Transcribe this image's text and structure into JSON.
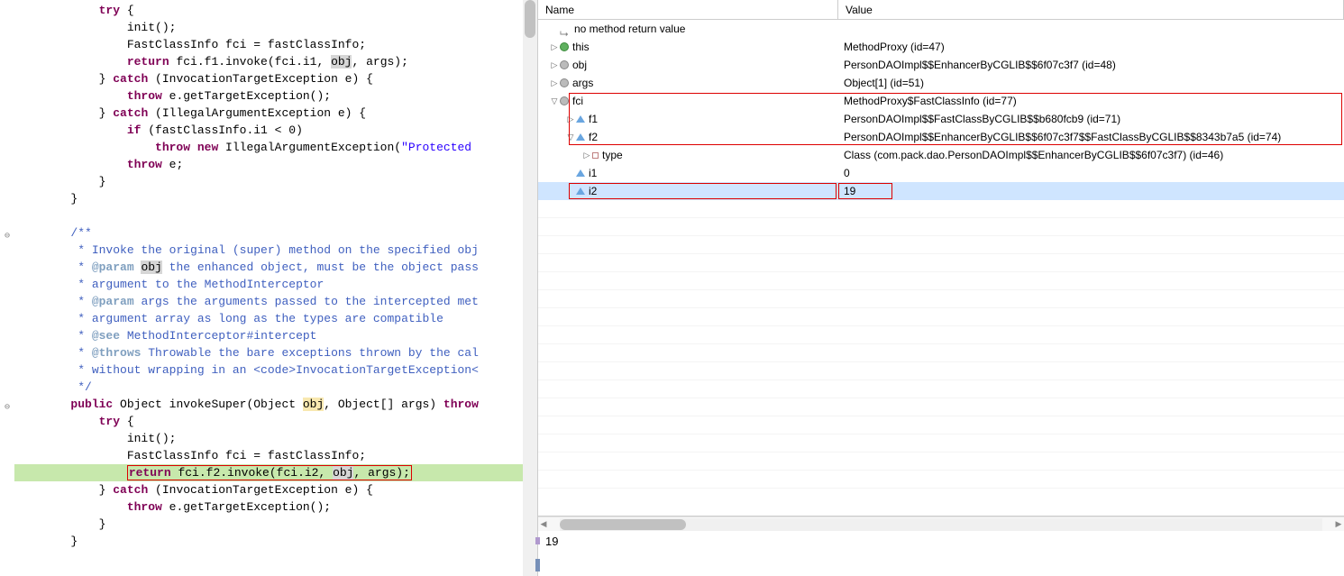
{
  "code_lines": [
    {
      "indent": 2,
      "segments": [
        {
          "t": "try",
          "c": "kw"
        },
        {
          "t": " {"
        }
      ]
    },
    {
      "indent": 3,
      "segments": [
        {
          "t": "init();"
        }
      ]
    },
    {
      "indent": 3,
      "segments": [
        {
          "t": "FastClassInfo fci = fastClassInfo;"
        }
      ]
    },
    {
      "indent": 3,
      "segments": [
        {
          "t": "return",
          "c": "kw"
        },
        {
          "t": " fci.f1.invoke(fci.i1, "
        },
        {
          "t": "obj",
          "c": "hl-var"
        },
        {
          "t": ", args);"
        }
      ]
    },
    {
      "indent": 2,
      "segments": [
        {
          "t": "} "
        },
        {
          "t": "catch",
          "c": "kw"
        },
        {
          "t": " (InvocationTargetException e) {"
        }
      ]
    },
    {
      "indent": 3,
      "segments": [
        {
          "t": "throw",
          "c": "kw"
        },
        {
          "t": " e.getTargetException();"
        }
      ]
    },
    {
      "indent": 2,
      "segments": [
        {
          "t": "} "
        },
        {
          "t": "catch",
          "c": "kw"
        },
        {
          "t": " (IllegalArgumentException e) {"
        }
      ]
    },
    {
      "indent": 3,
      "segments": [
        {
          "t": "if",
          "c": "kw"
        },
        {
          "t": " (fastClassInfo.i1 < 0)"
        }
      ]
    },
    {
      "indent": 4,
      "segments": [
        {
          "t": "throw new",
          "c": "kw"
        },
        {
          "t": " IllegalArgumentException("
        },
        {
          "t": "\"Protected",
          "c": "str"
        }
      ]
    },
    {
      "indent": 3,
      "segments": [
        {
          "t": "throw",
          "c": "kw"
        },
        {
          "t": " e;"
        }
      ]
    },
    {
      "indent": 2,
      "segments": [
        {
          "t": "}"
        }
      ]
    },
    {
      "indent": 1,
      "segments": [
        {
          "t": "}"
        }
      ]
    },
    {
      "indent": 0,
      "segments": [
        {
          "t": ""
        }
      ]
    },
    {
      "indent": 1,
      "segments": [
        {
          "t": "/**",
          "c": "cmt"
        }
      ],
      "fold": true
    },
    {
      "indent": 1,
      "segments": [
        {
          "t": " * Invoke the original (super) method on the specified obj",
          "c": "cmt"
        }
      ]
    },
    {
      "indent": 1,
      "segments": [
        {
          "t": " * ",
          "c": "cmt"
        },
        {
          "t": "@param",
          "c": "ann"
        },
        {
          "t": " ",
          "c": "cmt"
        },
        {
          "t": "obj",
          "c": "hl-var"
        },
        {
          "t": " the enhanced object, must be the object pass",
          "c": "cmt"
        }
      ]
    },
    {
      "indent": 1,
      "segments": [
        {
          "t": " * argument to the MethodInterceptor",
          "c": "cmt"
        }
      ]
    },
    {
      "indent": 1,
      "segments": [
        {
          "t": " * ",
          "c": "cmt"
        },
        {
          "t": "@param",
          "c": "ann"
        },
        {
          "t": " args the arguments passed to the intercepted met",
          "c": "cmt"
        }
      ]
    },
    {
      "indent": 1,
      "segments": [
        {
          "t": " * argument array as long as the types are compatible",
          "c": "cmt"
        }
      ]
    },
    {
      "indent": 1,
      "segments": [
        {
          "t": " * ",
          "c": "cmt"
        },
        {
          "t": "@see",
          "c": "ann"
        },
        {
          "t": " MethodInterceptor#intercept",
          "c": "cmt"
        }
      ]
    },
    {
      "indent": 1,
      "segments": [
        {
          "t": " * ",
          "c": "cmt"
        },
        {
          "t": "@throws",
          "c": "ann"
        },
        {
          "t": " Throwable the bare exceptions thrown by the cal",
          "c": "cmt"
        }
      ]
    },
    {
      "indent": 1,
      "segments": [
        {
          "t": " * without wrapping in an <code>InvocationTargetException<",
          "c": "cmt"
        }
      ]
    },
    {
      "indent": 1,
      "segments": [
        {
          "t": " */",
          "c": "cmt"
        }
      ]
    },
    {
      "indent": 1,
      "segments": [
        {
          "t": "public",
          "c": "kw"
        },
        {
          "t": " Object invokeSuper(Object "
        },
        {
          "t": "obj",
          "c": "hl-sel"
        },
        {
          "t": ", Object[] args) "
        },
        {
          "t": "throw",
          "c": "kw"
        }
      ],
      "fold": true
    },
    {
      "indent": 2,
      "segments": [
        {
          "t": "try",
          "c": "kw"
        },
        {
          "t": " {"
        }
      ]
    },
    {
      "indent": 3,
      "segments": [
        {
          "t": "init();"
        }
      ]
    },
    {
      "indent": 3,
      "segments": [
        {
          "t": "FastClassInfo fci = fastClassInfo;"
        }
      ]
    },
    {
      "indent": 3,
      "debug": true,
      "box": true,
      "segments": [
        {
          "t": "return",
          "c": "kw"
        },
        {
          "t": " fci.f2.invoke(fci.i2, "
        },
        {
          "t": "obj",
          "c": "hl-var"
        },
        {
          "t": ", args);"
        }
      ]
    },
    {
      "indent": 2,
      "segments": [
        {
          "t": "} "
        },
        {
          "t": "catch",
          "c": "kw"
        },
        {
          "t": " (InvocationTargetException e) {"
        }
      ]
    },
    {
      "indent": 3,
      "segments": [
        {
          "t": "throw",
          "c": "kw"
        },
        {
          "t": " e.getTargetException();"
        }
      ]
    },
    {
      "indent": 2,
      "segments": [
        {
          "t": "}"
        }
      ]
    },
    {
      "indent": 1,
      "segments": [
        {
          "t": "}"
        }
      ]
    },
    {
      "indent": 0,
      "segments": [
        {
          "t": ""
        }
      ]
    }
  ],
  "vars_header": {
    "name": "Name",
    "value": "Value"
  },
  "no_return": "no method return value",
  "vars": [
    {
      "depth": 0,
      "tw": ">",
      "icon": "green",
      "name": "this",
      "value": "MethodProxy  (id=47)"
    },
    {
      "depth": 0,
      "tw": ">",
      "icon": "gray",
      "name": "obj",
      "value": "PersonDAOImpl$$EnhancerByCGLIB$$6f07c3f7  (id=48)"
    },
    {
      "depth": 0,
      "tw": ">",
      "icon": "gray",
      "name": "args",
      "value": "Object[1]  (id=51)"
    },
    {
      "depth": 0,
      "tw": "v",
      "icon": "gray",
      "name": "fci",
      "value": "MethodProxy$FastClassInfo  (id=77)",
      "redRow": true
    },
    {
      "depth": 1,
      "tw": ">",
      "icon": "tri",
      "name": "f1",
      "value": "PersonDAOImpl$$FastClassByCGLIB$$b680fcb9  (id=71)",
      "redRow": true
    },
    {
      "depth": 1,
      "tw": "v",
      "icon": "tri",
      "name": "f2",
      "value": "PersonDAOImpl$$EnhancerByCGLIB$$6f07c3f7$$FastClassByCGLIB$$8343b7a5  (id=74)",
      "redRow": true
    },
    {
      "depth": 2,
      "tw": ">",
      "icon": "sq",
      "name": "type",
      "value": "Class<T> (com.pack.dao.PersonDAOImpl$$EnhancerByCGLIB$$6f07c3f7) (id=46)"
    },
    {
      "depth": 1,
      "tw": "",
      "icon": "tri",
      "name": "i1",
      "value": "0"
    },
    {
      "depth": 1,
      "tw": "",
      "icon": "tri",
      "name": "i2",
      "value": "19",
      "selected": true,
      "redCells": true
    }
  ],
  "detail_value": "19"
}
